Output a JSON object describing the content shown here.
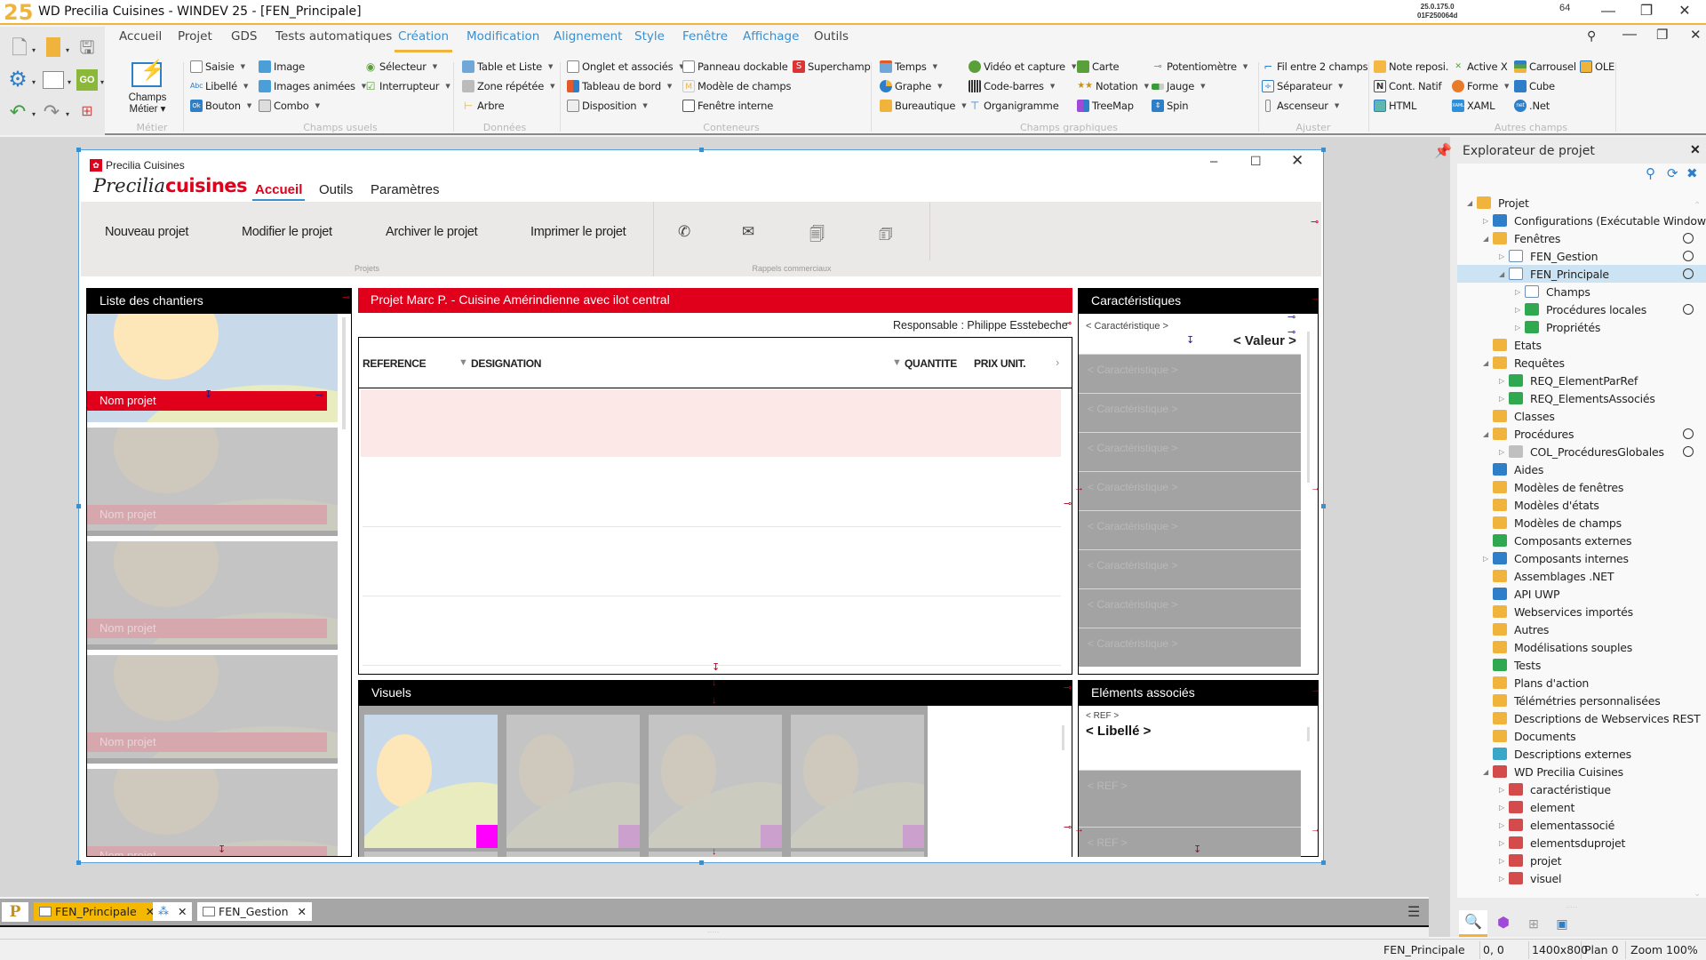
{
  "app": {
    "title": "WD Precilia Cuisines - WINDEV 25 - [FEN_Principale]",
    "logo": "25",
    "version_line1": "25.0.175.0",
    "version_line2": "01F250064d",
    "bits": "64",
    "window_controls": {
      "minimize": "—",
      "maximize": "❐",
      "close": "✕"
    }
  },
  "ribbon": {
    "tabs": [
      {
        "label": "Accueil"
      },
      {
        "label": "Projet"
      },
      {
        "label": "GDS"
      },
      {
        "label": "Tests automatiques"
      },
      {
        "label": "Création",
        "active": true
      },
      {
        "label": "Modification"
      },
      {
        "label": "Alignement"
      },
      {
        "label": "Style"
      },
      {
        "label": "Fenêtre"
      },
      {
        "label": "Affichage"
      },
      {
        "label": "Outils"
      }
    ],
    "big_button": {
      "label1": "Champs",
      "label2": "Métier ▾"
    },
    "groups": {
      "metier": "Métier",
      "champs_usuels": "Champs usuels",
      "donnees": "Données",
      "conteneurs": "Conteneurs",
      "champs_graphiques": "Champs graphiques",
      "ajuster": "Ajuster",
      "autres_champs": "Autres champs"
    },
    "items": {
      "saisie": "Saisie",
      "libelle": "Libellé",
      "bouton": "Bouton",
      "image": "Image",
      "images_animees": "Images animées",
      "combo": "Combo",
      "selecteur": "Sélecteur",
      "interrupteur": "Interrupteur",
      "table_liste": "Table et Liste",
      "zone_repetee": "Zone répétée",
      "arbre": "Arbre",
      "onglet": "Onglet et associés",
      "tableau_bord": "Tableau de bord",
      "disposition": "Disposition",
      "panneau_dockable": "Panneau dockable",
      "modele_champs": "Modèle de champs",
      "fenetre_interne": "Fenêtre interne",
      "superchamp": "Superchamp",
      "temps": "Temps",
      "graphe": "Graphe",
      "bureautique": "Bureautique",
      "video": "Vidéo et capture",
      "code_barres": "Code-barres",
      "organigramme": "Organigramme",
      "carte": "Carte",
      "notation": "Notation",
      "treemap": "TreeMap",
      "potentiometre": "Potentiomètre",
      "jauge": "Jauge",
      "spin": "Spin",
      "fil": "Fil entre 2 champs",
      "separateur": "Séparateur",
      "ascenseur": "Ascenseur",
      "note": "Note reposi.",
      "cont_natif": "Cont. Natif",
      "html": "HTML",
      "activex": "Active X",
      "forme": "Forme",
      "xaml": "XAML",
      "carrousel": "Carrousel",
      "cube": "Cube",
      "net": ".Net",
      "ole": "OLE"
    }
  },
  "design_window": {
    "title": "Precilia Cuisines",
    "brand_script": "Precilia",
    "brand_bold": "cuisines",
    "tabs": [
      {
        "label": "Accueil",
        "active": true
      },
      {
        "label": "Outils"
      },
      {
        "label": "Paramètres"
      }
    ],
    "actions": [
      "Nouveau projet",
      "Modifier le projet",
      "Archiver le projet",
      "Imprimer le projet"
    ],
    "group_projets": "Projets",
    "group_rappels": "Rappels commerciaux",
    "chantiers": {
      "title": "Liste des chantiers",
      "item_label": "Nom projet",
      "item_count": 5
    },
    "projet": {
      "title": "Projet Marc P. - Cuisine Amérindienne avec ilot central",
      "responsable": "Responsable : Philippe Esstebeche",
      "columns": [
        "REFERENCE",
        "DESIGNATION",
        "QUANTITE",
        "PRIX UNIT."
      ]
    },
    "caracteristiques": {
      "title": "Caractéristiques",
      "label": "< Caractéristique >",
      "value": "< Valeur >",
      "ghost_rows": [
        "< Caractéristique >",
        "< Caractéristique >",
        "< Caractéristique >",
        "< Caractéristique >",
        "< Caractéristique >",
        "< Caractéristique >",
        "< Caractéristique >",
        "< Caractéristique >"
      ]
    },
    "visuels": {
      "title": "Visuels",
      "count": 4
    },
    "elements_associes": {
      "title": "Eléments associés",
      "ref": "< REF >",
      "libelle": "< Libellé >",
      "ghost_rows": [
        "< REF >",
        "< REF >"
      ]
    }
  },
  "explorer": {
    "title": "Explorateur de projet",
    "tree": [
      {
        "label": "Projet",
        "level": 0,
        "toggle": "◢",
        "icon": "project-icon",
        "color": "#f0b43c"
      },
      {
        "label": "Configurations (Exécutable Windows",
        "level": 1,
        "toggle": "▷",
        "icon": "gear-icon",
        "color": "#2f7fc8"
      },
      {
        "label": "Fenêtres",
        "level": 1,
        "toggle": "◢",
        "icon": "folder-icon",
        "color": "#f0b43c",
        "ring": true
      },
      {
        "label": "FEN_Gestion",
        "level": 2,
        "toggle": "▷",
        "icon": "window-icon",
        "color": "#ffffff",
        "ring": true
      },
      {
        "label": "FEN_Principale",
        "level": 2,
        "toggle": "◢",
        "icon": "window-icon",
        "color": "#ffffff",
        "ring": true,
        "selected": true
      },
      {
        "label": "Champs",
        "level": 3,
        "toggle": "▷",
        "icon": "field-icon",
        "color": "#ffffff"
      },
      {
        "label": "Procédures locales",
        "level": 3,
        "toggle": "▷",
        "icon": "procedure-icon",
        "color": "#2fa84f",
        "ring": true
      },
      {
        "label": "Propriétés",
        "level": 3,
        "toggle": "▷",
        "icon": "properties-icon",
        "color": "#2fa84f"
      },
      {
        "label": "Etats",
        "level": 1,
        "toggle": "",
        "icon": "report-folder-icon",
        "color": "#f0b43c"
      },
      {
        "label": "Requêtes",
        "level": 1,
        "toggle": "◢",
        "icon": "query-folder-icon",
        "color": "#f0b43c"
      },
      {
        "label": "REQ_ElementParRef",
        "level": 2,
        "toggle": "▷",
        "icon": "query-icon",
        "color": "#2fa84f"
      },
      {
        "label": "REQ_ElementsAssociés",
        "level": 2,
        "toggle": "▷",
        "icon": "query-icon",
        "color": "#2fa84f"
      },
      {
        "label": "Classes",
        "level": 1,
        "toggle": "",
        "icon": "class-icon",
        "color": "#f0b43c"
      },
      {
        "label": "Procédures",
        "level": 1,
        "toggle": "◢",
        "icon": "procedures-folder-icon",
        "color": "#f0b43c",
        "ring": true
      },
      {
        "label": "COL_ProcéduresGlobales",
        "level": 2,
        "toggle": "▷",
        "icon": "global-procedures-icon",
        "color": "#c0c0c0",
        "ring": true
      },
      {
        "label": "Aides",
        "level": 1,
        "toggle": "",
        "icon": "help-icon",
        "color": "#2f7fc8"
      },
      {
        "label": "Modèles de fenêtres",
        "level": 1,
        "toggle": "",
        "icon": "window-template-icon",
        "color": "#f0b43c"
      },
      {
        "label": "Modèles d'états",
        "level": 1,
        "toggle": "",
        "icon": "report-template-icon",
        "color": "#f0b43c"
      },
      {
        "label": "Modèles de champs",
        "level": 1,
        "toggle": "",
        "icon": "field-template-icon",
        "color": "#f0b43c"
      },
      {
        "label": "Composants externes",
        "level": 1,
        "toggle": "",
        "icon": "external-component-icon",
        "color": "#2fa84f"
      },
      {
        "label": "Composants internes",
        "level": 1,
        "toggle": "▷",
        "icon": "internal-component-icon",
        "color": "#2f7fc8"
      },
      {
        "label": "Assemblages .NET",
        "level": 1,
        "toggle": "",
        "icon": "dotnet-assembly-icon",
        "color": "#f0b43c"
      },
      {
        "label": "API UWP",
        "level": 1,
        "toggle": "",
        "icon": "uwp-icon",
        "color": "#2f7fc8"
      },
      {
        "label": "Webservices importés",
        "level": 1,
        "toggle": "",
        "icon": "webservice-icon",
        "color": "#f0b43c"
      },
      {
        "label": "Autres",
        "level": 1,
        "toggle": "",
        "icon": "other-icon",
        "color": "#f0b43c"
      },
      {
        "label": "Modélisations souples",
        "level": 1,
        "toggle": "",
        "icon": "modeling-icon",
        "color": "#f0b43c"
      },
      {
        "label": "Tests",
        "level": 1,
        "toggle": "",
        "icon": "tests-icon",
        "color": "#2fa84f"
      },
      {
        "label": "Plans d'action",
        "level": 1,
        "toggle": "",
        "icon": "action-plan-icon",
        "color": "#f0b43c"
      },
      {
        "label": "Télémétries personnalisées",
        "level": 1,
        "toggle": "",
        "icon": "telemetry-icon",
        "color": "#f0b43c"
      },
      {
        "label": "Descriptions de Webservices REST",
        "level": 1,
        "toggle": "",
        "icon": "rest-icon",
        "color": "#f0b43c"
      },
      {
        "label": "Documents",
        "level": 1,
        "toggle": "",
        "icon": "documents-icon",
        "color": "#f0b43c"
      },
      {
        "label": "Descriptions externes",
        "level": 1,
        "toggle": "",
        "icon": "external-description-icon",
        "color": "#3aa6c8"
      },
      {
        "label": "WD Precilia Cuisines",
        "level": 1,
        "toggle": "◢",
        "icon": "analysis-icon",
        "color": "#d34b4b"
      },
      {
        "label": "caractéristique",
        "level": 2,
        "toggle": "▷",
        "icon": "table-icon",
        "color": "#d34b4b"
      },
      {
        "label": "element",
        "level": 2,
        "toggle": "▷",
        "icon": "table-icon",
        "color": "#d34b4b"
      },
      {
        "label": "elementassocié",
        "level": 2,
        "toggle": "▷",
        "icon": "table-icon",
        "color": "#d34b4b"
      },
      {
        "label": "elementsduprojet",
        "level": 2,
        "toggle": "▷",
        "icon": "table-icon",
        "color": "#d34b4b"
      },
      {
        "label": "projet",
        "level": 2,
        "toggle": "▷",
        "icon": "table-icon",
        "color": "#d34b4b"
      },
      {
        "label": "visuel",
        "level": 2,
        "toggle": "▷",
        "icon": "table-icon",
        "color": "#d34b4b"
      }
    ]
  },
  "doc_tabs": [
    {
      "label": "FEN_Principale",
      "active": true,
      "close": "✕"
    },
    {
      "label": "",
      "close": "✕"
    },
    {
      "label": "FEN_Gestion",
      "close": "✕"
    }
  ],
  "status": {
    "window": "FEN_Principale",
    "position": "0, 0",
    "size": "1400x800",
    "plan": "Plan 0",
    "zoom": "Zoom 100%"
  },
  "colors": {
    "accent": "#f0b43c",
    "brand_red": "#e0001b",
    "link_blue": "#3a8fcf"
  }
}
